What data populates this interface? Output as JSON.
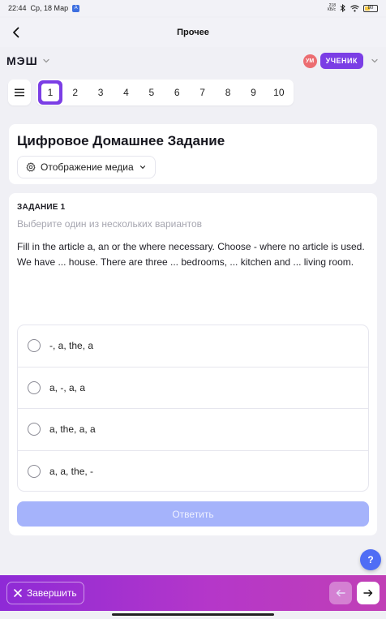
{
  "status_bar": {
    "time": "22:44",
    "date": "Ср, 18 Мар",
    "speed_value": "218",
    "speed_unit": "КБ/с",
    "battery": "80"
  },
  "title_bar": {
    "title": "Прочее"
  },
  "app_header": {
    "logo": "МЭШ",
    "avatar_initials": "УМ",
    "role": "УЧЕНИК"
  },
  "navigator": {
    "questions": [
      "1",
      "2",
      "3",
      "4",
      "5",
      "6",
      "7",
      "8",
      "9",
      "10"
    ],
    "active_index": 0
  },
  "assignment": {
    "title": "Цифровое Домашнее Задание",
    "media_button": "Отображение медиа"
  },
  "task": {
    "label": "ЗАДАНИЕ 1",
    "hint": "Выберите один из нескольких вариантов",
    "text_line1": "Fill in the article a, an or the where necessary. Choose  -  where no article is used.",
    "text_line2": "We have ... house. There are three ... bedrooms, ... kitchen and ... living room.",
    "options": [
      "-, a, the, a",
      "a, -, a, a",
      "a, the, a, a",
      "a, a, the, -"
    ],
    "answer_button": "Ответить"
  },
  "help": {
    "label": "?"
  },
  "bottom_bar": {
    "finish_label": "Завершить"
  },
  "colors": {
    "accent_purple": "#7b3ee5",
    "answer_disabled": "#a5b3fb",
    "help_blue": "#4f6df5",
    "avatar": "#ec6d71"
  }
}
